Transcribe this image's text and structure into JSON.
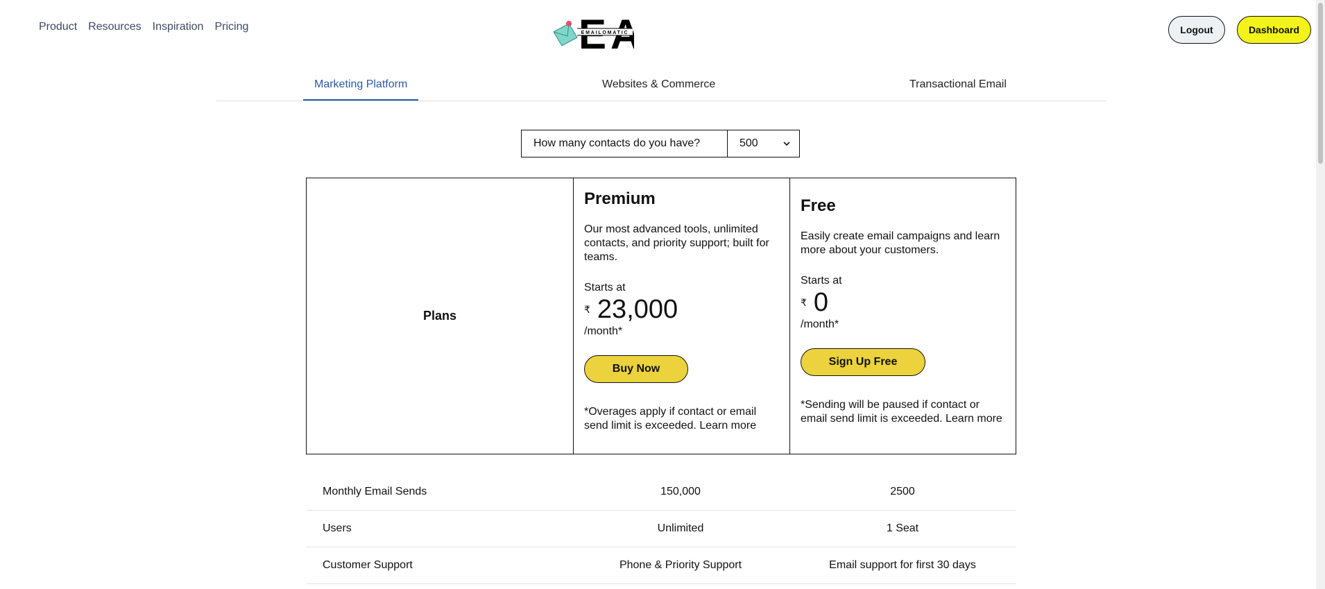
{
  "nav": {
    "links": [
      "Product",
      "Resources",
      "Inspiration",
      "Pricing"
    ],
    "logo_text": "EA",
    "logo_wordmark": "EMAILOMATIC",
    "logout": "Logout",
    "dashboard": "Dashboard"
  },
  "tabs": [
    "Marketing Platform",
    "Websites & Commerce",
    "Transactional Email"
  ],
  "contacts": {
    "question": "How many contacts do you have?",
    "selected": "500"
  },
  "plans": {
    "label": "Plans",
    "premium": {
      "title": "Premium",
      "desc": "Our most advanced tools, unlimited contacts, and priority support; built for teams.",
      "starts_at": "Starts at",
      "currency": "₹",
      "amount": "23,000",
      "period": "/month*",
      "cta": "Buy Now",
      "note": "*Overages apply if contact or email send limit is exceeded.",
      "learn_more": "Learn more"
    },
    "free": {
      "title": "Free",
      "desc": "Easily create email campaigns and learn more about your customers.",
      "starts_at": "Starts at",
      "currency": "₹",
      "amount": "0",
      "period": "/month*",
      "cta": "Sign Up Free",
      "note": "*Sending will be paused if contact or email send limit is exceeded.",
      "learn_more": "Learn more"
    }
  },
  "features": [
    {
      "name": "Monthly Email Sends",
      "premium": "150,000",
      "free": "2500"
    },
    {
      "name": "Users",
      "premium": "Unlimited",
      "free": "1 Seat"
    },
    {
      "name": "Customer Support",
      "premium": "Phone & Priority Support",
      "free": "Email support for first 30 days"
    }
  ],
  "colors": {
    "accent_blue": "#2b5aa8",
    "cta_yellow": "#ecd23c",
    "dashboard_yellow": "#f3f31a"
  }
}
